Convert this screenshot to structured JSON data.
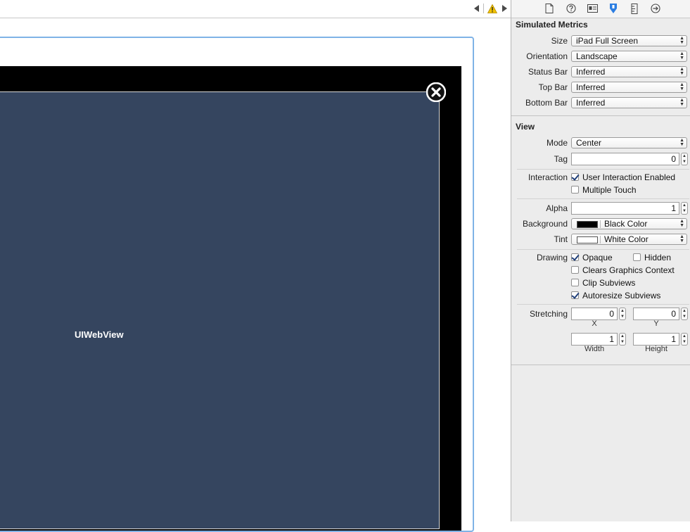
{
  "canvas": {
    "webview_label": "UIWebView"
  },
  "inspector": {
    "simulated_metrics": {
      "title": "Simulated Metrics",
      "rows": [
        {
          "label": "Size",
          "value": "iPad Full Screen"
        },
        {
          "label": "Orientation",
          "value": "Landscape"
        },
        {
          "label": "Status Bar",
          "value": "Inferred"
        },
        {
          "label": "Top Bar",
          "value": "Inferred"
        },
        {
          "label": "Bottom Bar",
          "value": "Inferred"
        }
      ]
    },
    "view": {
      "title": "View",
      "mode_label": "Mode",
      "mode_value": "Center",
      "tag_label": "Tag",
      "tag_value": "0",
      "interaction_label": "Interaction",
      "user_interaction_label": "User Interaction Enabled",
      "user_interaction_checked": true,
      "multiple_touch_label": "Multiple Touch",
      "multiple_touch_checked": false,
      "alpha_label": "Alpha",
      "alpha_value": "1",
      "background_label": "Background",
      "background_value": "Black Color",
      "background_color": "#000000",
      "tint_label": "Tint",
      "tint_value": "White Color",
      "tint_color": "#ffffff",
      "drawing_label": "Drawing",
      "opaque_label": "Opaque",
      "opaque_checked": true,
      "hidden_label": "Hidden",
      "hidden_checked": false,
      "clears_label": "Clears Graphics Context",
      "clears_checked": false,
      "clip_label": "Clip Subviews",
      "clip_checked": false,
      "autoresize_label": "Autoresize Subviews",
      "autoresize_checked": true,
      "stretching_label": "Stretching",
      "stretch_x": "0",
      "stretch_y": "0",
      "stretch_x_caption": "X",
      "stretch_y_caption": "Y",
      "stretch_width": "1",
      "stretch_height": "1",
      "stretch_width_caption": "Width",
      "stretch_height_caption": "Height"
    }
  },
  "colors": {
    "webview_background": "#35455f",
    "scene_selection": "#7fb3e6",
    "warning": "#f2c300",
    "inspector_active_tab": "#2b7de1"
  }
}
